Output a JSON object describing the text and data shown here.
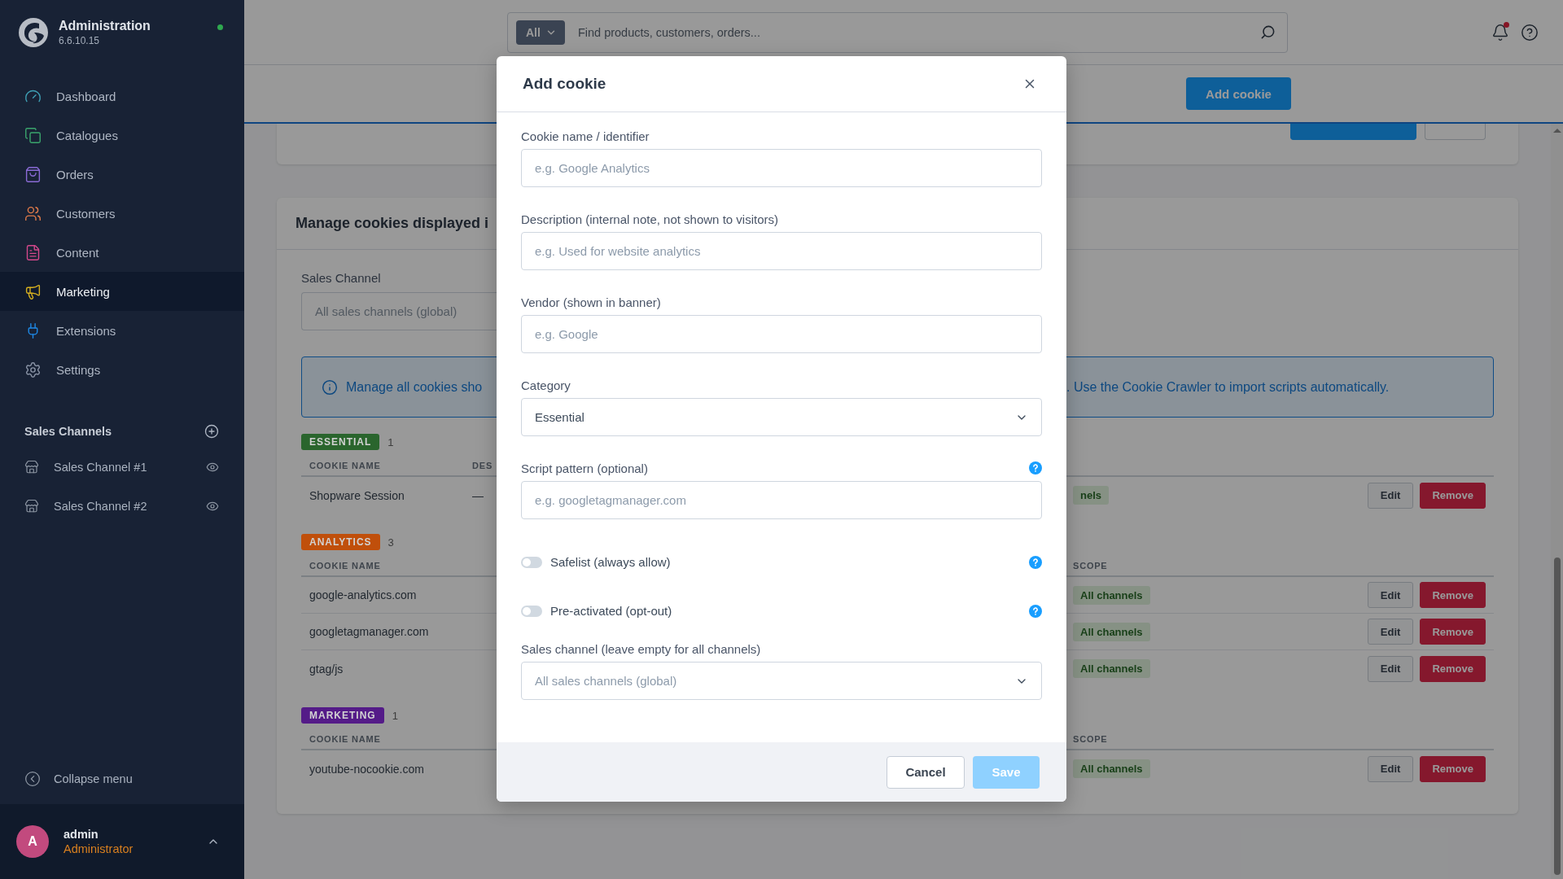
{
  "sidebar": {
    "brand": {
      "title": "Administration",
      "version": "6.6.10.15",
      "online": true
    },
    "nav": [
      {
        "label": "Dashboard",
        "selected": false
      },
      {
        "label": "Catalogues",
        "selected": false
      },
      {
        "label": "Orders",
        "selected": false
      },
      {
        "label": "Customers",
        "selected": false
      },
      {
        "label": "Content",
        "selected": false
      },
      {
        "label": "Marketing",
        "selected": true
      },
      {
        "label": "Extensions",
        "selected": false
      },
      {
        "label": "Settings",
        "selected": false
      }
    ],
    "sales_channels": {
      "title": "Sales Channels",
      "items": [
        {
          "label": "Sales Channel #1"
        },
        {
          "label": "Sales Channel #2"
        }
      ]
    },
    "collapse": "Collapse menu",
    "user": {
      "initial": "A",
      "name": "admin",
      "role": "Administrator"
    }
  },
  "topbar": {
    "search": {
      "scope": "All",
      "placeholder": "Find products, customers, orders..."
    },
    "notifications_unread": true
  },
  "header": {
    "primary_button": "Add cookie"
  },
  "page": {
    "card_title": "Manage cookies displayed i",
    "sales_channel": {
      "label": "Sales Channel",
      "placeholder": "All sales channels (global)"
    },
    "info": [
      "Manage all cookies sho",
      ". Use the Cookie Crawler to import scripts automatically."
    ],
    "groups": [
      {
        "category": "ESSENTIAL",
        "color": "#2a652d",
        "count": "1",
        "columns": {
          "name": "COOKIE NAME",
          "description": "DES"
        },
        "rows": [
          {
            "name": "Shopware Session",
            "description": "—",
            "scope": "nels",
            "actions": [
              {
                "label": "Edit",
                "kind": "edit"
              },
              {
                "label": "Remove",
                "kind": "remove"
              }
            ]
          }
        ]
      },
      {
        "category": "ANALYTICS",
        "color": "#c04f0b",
        "count": "3",
        "columns": {
          "name": "COOKIE NAME",
          "scope": "SCOPE"
        },
        "rows": [
          {
            "name": "google-analytics.com",
            "scope": "All channels",
            "actions": [
              {
                "label": "Edit",
                "kind": "edit"
              },
              {
                "label": "Remove",
                "kind": "remove"
              }
            ]
          },
          {
            "name": "googletagmanager.com",
            "scope": "All channels",
            "actions": [
              {
                "label": "Edit",
                "kind": "edit"
              },
              {
                "label": "Remove",
                "kind": "remove"
              }
            ]
          },
          {
            "name": "gtag/js",
            "scope": "All channels",
            "actions": [
              {
                "label": "Edit",
                "kind": "edit"
              },
              {
                "label": "Remove",
                "kind": "remove"
              }
            ]
          }
        ]
      },
      {
        "category": "MARKETING",
        "color": "#541b88",
        "count": "1",
        "columns": {
          "name": "COOKIE NAME",
          "scope": "SCOPE"
        },
        "rows": [
          {
            "name": "youtube-nocookie.com",
            "scope": "All channels",
            "actions": [
              {
                "label": "Edit",
                "kind": "edit"
              },
              {
                "label": "Remove",
                "kind": "remove"
              }
            ]
          }
        ]
      }
    ]
  },
  "modal": {
    "title": "Add cookie",
    "fields": [
      {
        "kind": "text",
        "label": "Cookie name / identifier",
        "placeholder": "e.g. Google Analytics",
        "help": false
      },
      {
        "kind": "text",
        "label": "Description (internal note, not shown to visitors)",
        "placeholder": "e.g. Used for website analytics",
        "help": false
      },
      {
        "kind": "text",
        "label": "Vendor (shown in banner)",
        "placeholder": "e.g. Google",
        "help": false
      },
      {
        "kind": "select",
        "label": "Category",
        "value": "Essential",
        "help": false
      },
      {
        "kind": "text",
        "label": "Script pattern (optional)",
        "placeholder": "e.g. googletagmanager.com",
        "help": true
      },
      {
        "kind": "toggle",
        "label": "Safelist (always allow)",
        "on": false,
        "help": true
      },
      {
        "kind": "toggle",
        "label": "Pre-activated (opt-out)",
        "on": false,
        "help": true
      },
      {
        "kind": "select",
        "label": "Sales channel (leave empty for all channels)",
        "placeholder": "All sales channels (global)",
        "help": false
      }
    ],
    "cancel": "Cancel",
    "save": {
      "label": "Save",
      "disabled": true
    }
  }
}
